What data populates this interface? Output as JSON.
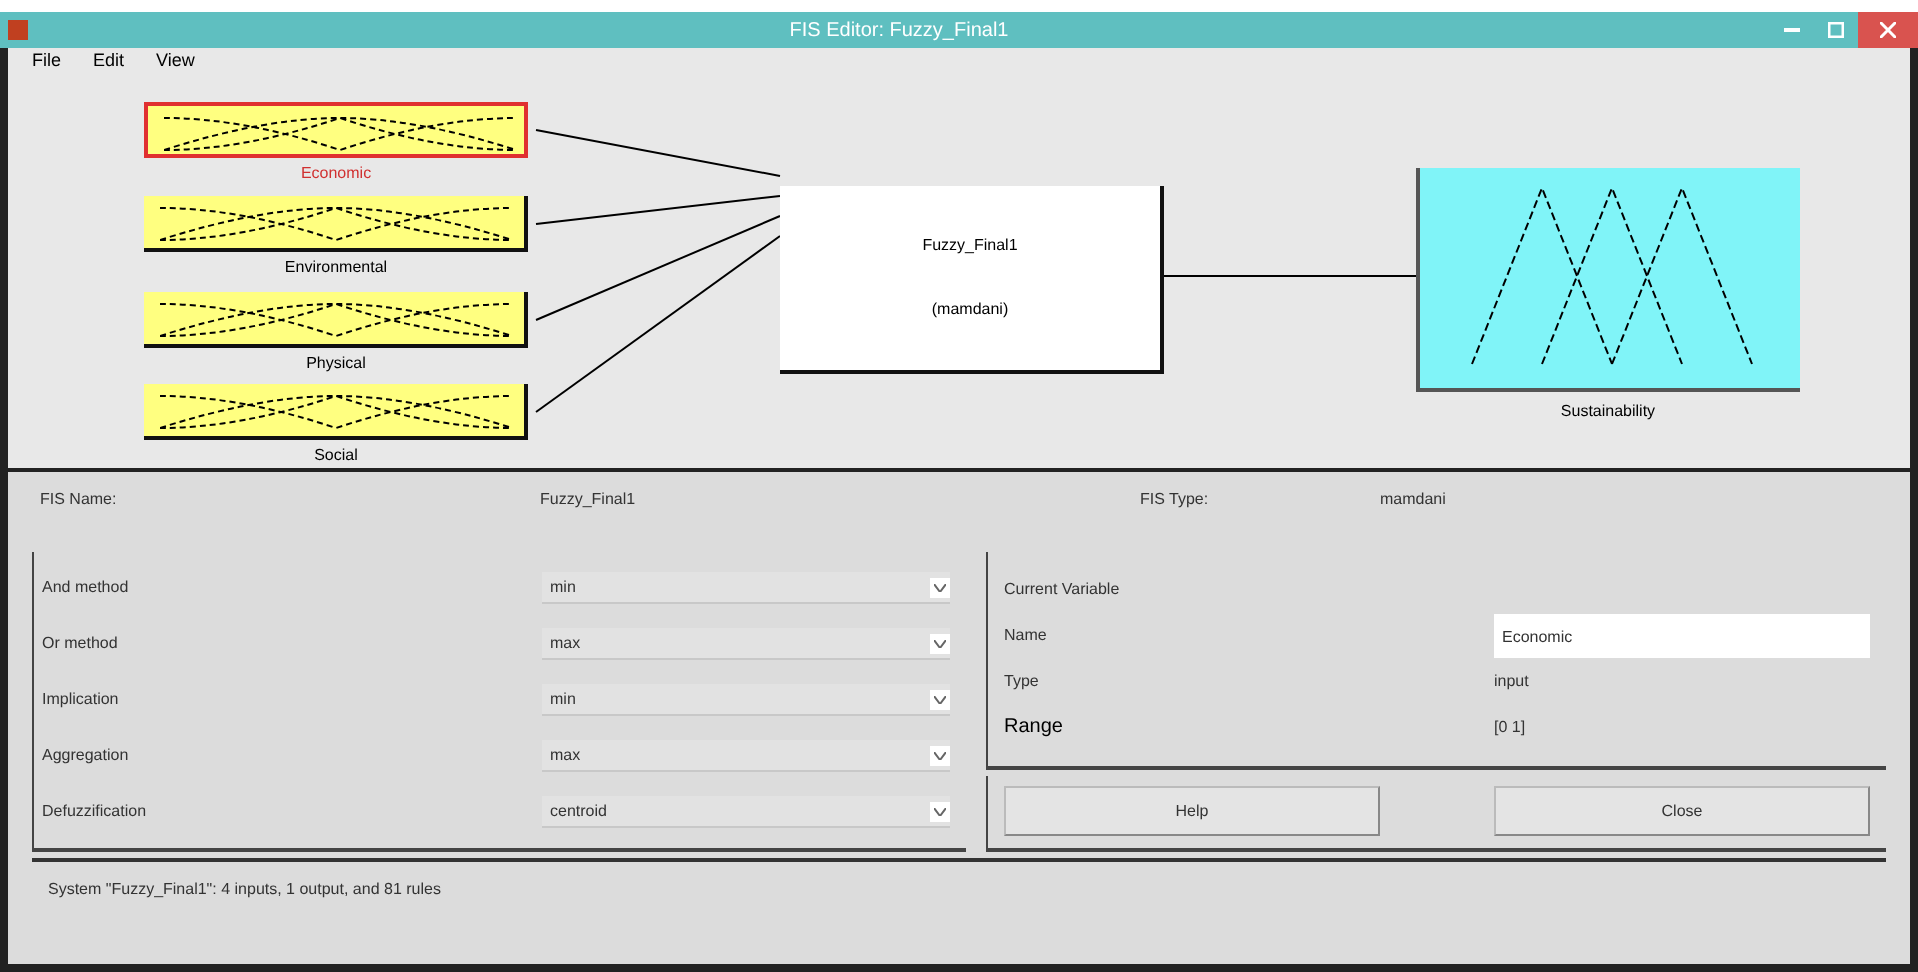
{
  "window": {
    "title": "FIS Editor: Fuzzy_Final1"
  },
  "menu": [
    "File",
    "Edit",
    "View"
  ],
  "inputs": [
    {
      "name": "Economic",
      "selected": true
    },
    {
      "name": "Environmental",
      "selected": false
    },
    {
      "name": "Physical",
      "selected": false
    },
    {
      "name": "Social",
      "selected": false
    }
  ],
  "system_box": {
    "name": "Fuzzy_Final1",
    "type": "(mamdani)"
  },
  "output": {
    "name": "Sustainability",
    "selected": false
  },
  "fis_info": {
    "name_label": "FIS Name:",
    "name_value": "Fuzzy_Final1",
    "type_label": "FIS Type:",
    "type_value": "mamdani"
  },
  "methods": [
    {
      "label": "And method",
      "value": "min"
    },
    {
      "label": "Or method",
      "value": "max"
    },
    {
      "label": "Implication",
      "value": "min"
    },
    {
      "label": "Aggregation",
      "value": "max"
    },
    {
      "label": "Defuzzification",
      "value": "centroid"
    }
  ],
  "current_variable": {
    "title": "Current Variable",
    "name_label": "Name",
    "name_value": "Economic",
    "type_label": "Type",
    "type_value": "input",
    "range_label": "Range",
    "range_value": "[0 1]"
  },
  "buttons": [
    "Help",
    "Close"
  ],
  "status": "System \"Fuzzy_Final1\": 4 inputs, 1 output, and 81 rules"
}
